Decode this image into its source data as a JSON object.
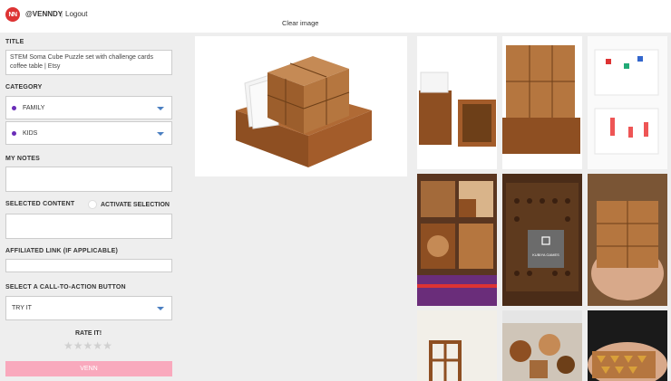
{
  "header": {
    "logo_text": "NN",
    "username": "@VENNDY",
    "separator": "|",
    "logout": "Logout",
    "clear_image": "Clear image"
  },
  "form": {
    "title_label": "TITLE",
    "title_value": "STEM Soma Cube Puzzle set with challenge cards coffee table | Etsy",
    "category_label": "CATEGORY",
    "categories": [
      "FAMILY",
      "KIDS"
    ],
    "category_dot_color": "#6a2db8",
    "notes_label": "MY NOTES",
    "selected_content_label": "SELECTED CONTENT",
    "activate_selection_label": "ACTIVATE SELECTION",
    "affiliated_label": "AFFILIATED LINK (If Applicable)",
    "cta_label": "SELECT A CALL-TO-ACTION BUTTON",
    "cta_value": "TRY IT",
    "rate_label": "RATE IT!",
    "star_count": 5,
    "submit_label": "VENN",
    "submit_color": "#f9a9bd"
  },
  "gallery": {
    "main_image_alt": "wooden puzzle cube box with challenge cards",
    "overlay_logo_text": "KUBIYA GAMES"
  }
}
